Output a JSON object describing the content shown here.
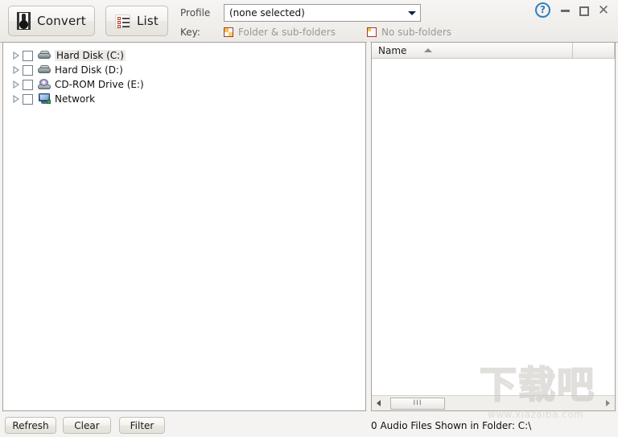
{
  "window": {
    "help_icon": "help-question-icon",
    "minimize_label": "",
    "maximize_label": "",
    "close_label": "✕"
  },
  "toolbar": {
    "convert_label": "Convert",
    "convert_icon": "microphone-icon",
    "list_label": "List",
    "list_icon": "checklist-icon",
    "profile_label": "Profile",
    "key_label": "Key:",
    "profile_value": "(none selected)",
    "profile_dropdown_icon": "chevron-down-icon",
    "key_items": [
      {
        "label": "Folder & sub-folders",
        "swatch": "full"
      },
      {
        "label": "No sub-folders",
        "swatch": "corner"
      }
    ]
  },
  "tree": {
    "items": [
      {
        "label": "Hard Disk (C:)",
        "icon": "hard-disk-icon",
        "checked": false,
        "expanded": false,
        "selected": true
      },
      {
        "label": "Hard Disk (D:)",
        "icon": "hard-disk-icon",
        "checked": false,
        "expanded": false,
        "selected": false
      },
      {
        "label": "CD-ROM Drive (E:)",
        "icon": "cd-rom-icon",
        "checked": false,
        "expanded": false,
        "selected": false
      },
      {
        "label": "Network",
        "icon": "network-icon",
        "checked": false,
        "expanded": false,
        "selected": false
      }
    ]
  },
  "file_panel": {
    "columns": [
      {
        "label": "Name",
        "sort": "ascending"
      }
    ],
    "rows": [],
    "scroll_grip": "III"
  },
  "bottom": {
    "refresh_label": "Refresh",
    "clear_label": "Clear",
    "filter_label": "Filter",
    "status": "0 Audio Files Shown in Folder: C:\\"
  },
  "watermark": {
    "text_cn": "下载吧",
    "url": "www.xiazaiba.com"
  }
}
